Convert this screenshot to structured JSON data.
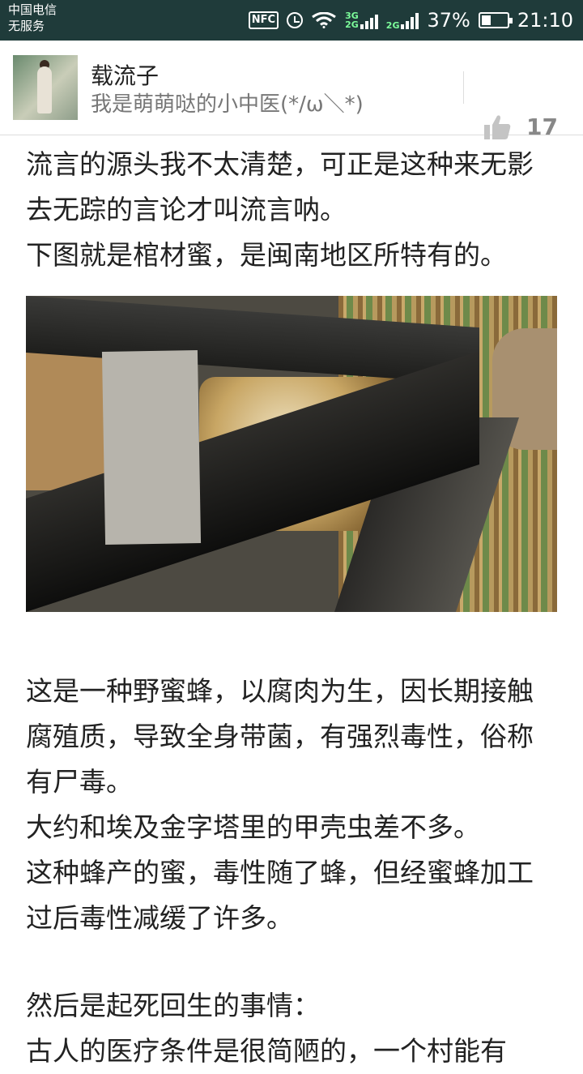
{
  "status_bar": {
    "carrier": "中国电信",
    "service": "无服务",
    "nfc": "NFC",
    "net_top": "3G",
    "net_bottom": "2G",
    "net_second": "2G",
    "battery_percent": "37%",
    "battery_level": 0.37,
    "time": "21:10"
  },
  "post_header": {
    "username": "载流子",
    "signature": "我是萌萌哒的小中医(*/ω＼*)",
    "like_count": "17",
    "like_icon": "thumbs-up-icon"
  },
  "content": {
    "para1": "流言的源头我不太清楚，可正是这种来无影去无踪的言论才叫流言呐。",
    "para2": "下图就是棺材蜜，是闽南地区所特有的。",
    "para3": "这是一种野蜜蜂，以腐肉为生，因长期接触腐殖质，导致全身带菌，有强烈毒性，俗称有尸毒。",
    "para4": "大约和埃及金字塔里的甲壳虫差不多。",
    "para5": "这种蜂产的蜜，毒性随了蜂，但经蜜蜂加工过后毒性减缓了许多。",
    "para6": "然后是起死回生的事情：",
    "para7": "古人的医疗条件是很简陋的，一个村能有"
  }
}
